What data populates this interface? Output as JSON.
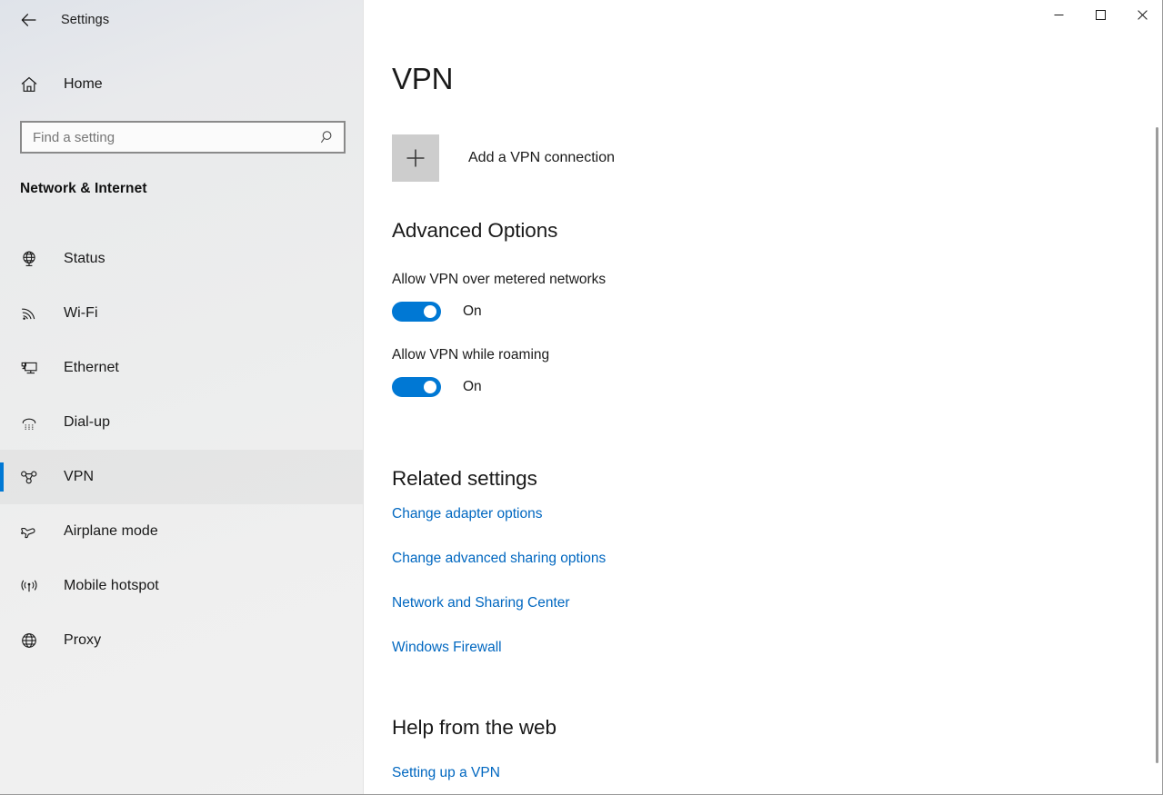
{
  "window": {
    "title": "Settings",
    "back_icon": "back-arrow-icon",
    "controls": {
      "minimize": "minimize-icon",
      "maximize": "maximize-icon",
      "close": "close-icon"
    }
  },
  "sidebar": {
    "home": {
      "label": "Home",
      "icon": "home-icon"
    },
    "search": {
      "value": "",
      "placeholder": "Find a setting",
      "icon": "search-icon"
    },
    "section_title": "Network & Internet",
    "items": [
      {
        "label": "Status",
        "icon": "globe-status-icon",
        "selected": false
      },
      {
        "label": "Wi-Fi",
        "icon": "wifi-icon",
        "selected": false
      },
      {
        "label": "Ethernet",
        "icon": "ethernet-icon",
        "selected": false
      },
      {
        "label": "Dial-up",
        "icon": "dialup-phone-icon",
        "selected": false
      },
      {
        "label": "VPN",
        "icon": "vpn-icon",
        "selected": true
      },
      {
        "label": "Airplane mode",
        "icon": "airplane-icon",
        "selected": false
      },
      {
        "label": "Mobile hotspot",
        "icon": "hotspot-icon",
        "selected": false
      },
      {
        "label": "Proxy",
        "icon": "globe-proxy-icon",
        "selected": false
      }
    ]
  },
  "main": {
    "page_title": "VPN",
    "add_vpn": {
      "label": "Add a VPN connection",
      "icon": "plus-icon"
    },
    "advanced": {
      "title": "Advanced Options",
      "options": [
        {
          "label": "Allow VPN over metered networks",
          "state": "On",
          "on": true
        },
        {
          "label": "Allow VPN while roaming",
          "state": "On",
          "on": true
        }
      ]
    },
    "related": {
      "title": "Related settings",
      "links": [
        "Change adapter options",
        "Change advanced sharing options",
        "Network and Sharing Center",
        "Windows Firewall"
      ]
    },
    "help": {
      "title": "Help from the web",
      "links": [
        "Setting up a VPN"
      ]
    }
  },
  "colors": {
    "accent": "#0078d4",
    "link": "#0067c0",
    "sidebar_bg": "#eceded",
    "content_bg": "#ffffff",
    "plus_button_bg": "#cdcdcd"
  }
}
